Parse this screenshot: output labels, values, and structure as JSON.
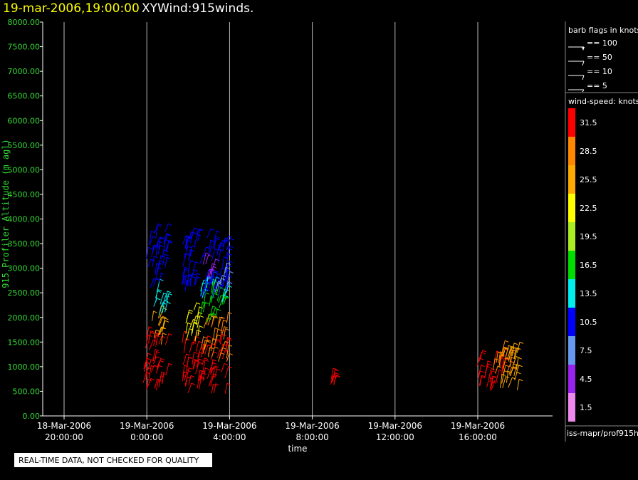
{
  "header": {
    "time": "19-mar-2006,19:00:00",
    "name": "XYWind:915winds."
  },
  "notice": "REAL-TIME DATA, NOT CHECKED FOR QUALITY",
  "source": "iss-mapr/prof915h",
  "chart_data": {
    "type": "scatter",
    "xlabel": "time",
    "ylabel": "915 Profiler Altitude (m agl)",
    "ylim": [
      0,
      8000
    ],
    "xlim_hours": [
      -26,
      24
    ],
    "grid": "vertical lines at each x tick",
    "yticks": [
      "0.00",
      "500.00",
      "1000.00",
      "1500.00",
      "2000.00",
      "2500.00",
      "3000.00",
      "3500.00",
      "4000.00",
      "4500.00",
      "5000.00",
      "5500.00",
      "6000.00",
      "6500.00",
      "7000.00",
      "7500.00",
      "8000.00"
    ],
    "xticks": [
      {
        "date": "18-Mar-2006",
        "time": "20:00:00"
      },
      {
        "date": "19-Mar-2006",
        "time": "0:00:00"
      },
      {
        "date": "19-Mar-2006",
        "time": "4:00:00"
      },
      {
        "date": "19-Mar-2006",
        "time": "8:00:00"
      },
      {
        "date": "19-Mar-2006",
        "time": "12:00:00"
      },
      {
        "date": "19-Mar-2006",
        "time": "16:00:00"
      }
    ],
    "legend_barbs_title": "barb flags in knots",
    "legend_barbs": [
      "== 100",
      "== 50",
      "== 10",
      "== 5"
    ],
    "legend_speed_title": "wind-speed: knots",
    "speed_classes": [
      {
        "label": "31.5",
        "color": "#ff0000"
      },
      {
        "label": "28.5",
        "color": "#ff8800"
      },
      {
        "label": "25.5",
        "color": "#ffaa00"
      },
      {
        "label": "22.5",
        "color": "#ffff00"
      },
      {
        "label": "19.5",
        "color": "#aaee22"
      },
      {
        "label": "16.5",
        "color": "#00dd00"
      },
      {
        "label": "13.5",
        "color": "#00eeee"
      },
      {
        "label": "10.5",
        "color": "#0000ff"
      },
      {
        "label": "7.5",
        "color": "#6699ee"
      },
      {
        "label": "4.5",
        "color": "#9922ee"
      },
      {
        "label": "1.5",
        "color": "#ee88ee"
      }
    ],
    "groups": [
      {
        "t0": -0.2,
        "t1": 1.0,
        "h0": 500,
        "h1": 1600,
        "speed": 31.5
      },
      {
        "t0": 0.2,
        "t1": 1.0,
        "h0": 1400,
        "h1": 2000,
        "speed": 25.5
      },
      {
        "t0": 0.3,
        "t1": 1.0,
        "h0": 2000,
        "h1": 2600,
        "speed": 13.5
      },
      {
        "t0": 0.0,
        "t1": 1.0,
        "h0": 2600,
        "h1": 3800,
        "speed": 10.5
      },
      {
        "t0": 1.7,
        "t1": 3.9,
        "h0": 450,
        "h1": 1500,
        "speed": 31.5
      },
      {
        "t0": 2.6,
        "t1": 3.9,
        "h0": 1100,
        "h1": 1900,
        "speed": 28.5
      },
      {
        "t0": 1.7,
        "t1": 2.5,
        "h0": 1500,
        "h1": 2200,
        "speed": 22.5
      },
      {
        "t0": 2.4,
        "t1": 3.9,
        "h0": 1900,
        "h1": 2500,
        "speed": 16.5
      },
      {
        "t0": 2.6,
        "t1": 3.8,
        "h0": 2300,
        "h1": 2700,
        "speed": 13.5
      },
      {
        "t0": 1.7,
        "t1": 3.9,
        "h0": 2400,
        "h1": 3700,
        "speed": 10.5
      },
      {
        "t0": 2.6,
        "t1": 3.3,
        "h0": 2700,
        "h1": 3100,
        "speed": 4.5
      },
      {
        "t0": 3.3,
        "t1": 3.9,
        "h0": 2500,
        "h1": 3000,
        "speed": 7.5
      },
      {
        "t0": 8.8,
        "t1": 9.1,
        "h0": 600,
        "h1": 800,
        "speed": 31.5
      },
      {
        "t0": 15.9,
        "t1": 17.2,
        "h0": 500,
        "h1": 1200,
        "speed": 31.5
      },
      {
        "t0": 16.6,
        "t1": 17.6,
        "h0": 800,
        "h1": 1400,
        "speed": 28.5
      },
      {
        "t0": 17.0,
        "t1": 18.0,
        "h0": 500,
        "h1": 1400,
        "speed": 25.5
      }
    ]
  }
}
